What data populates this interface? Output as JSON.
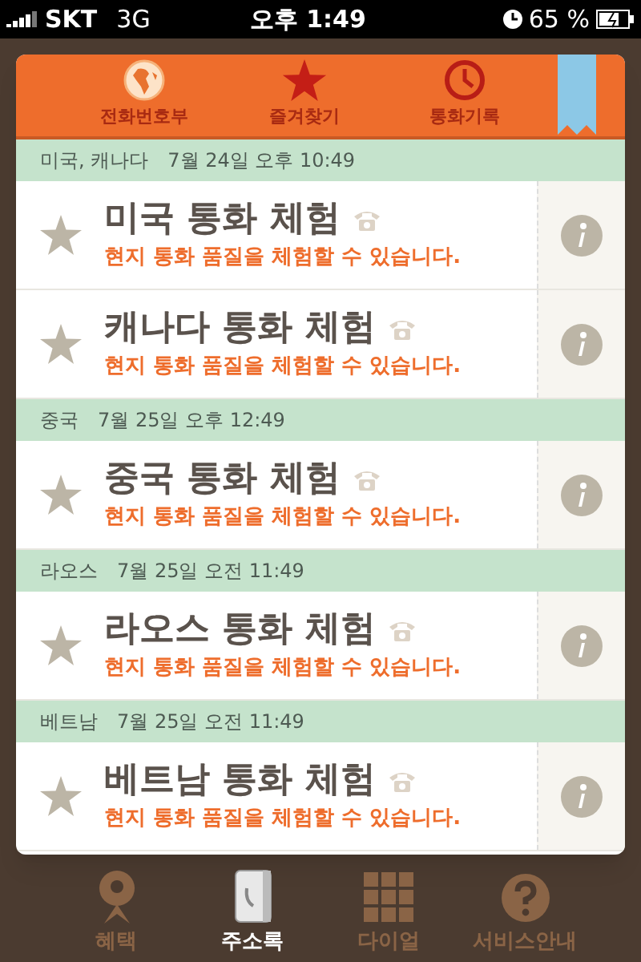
{
  "status_bar": {
    "carrier": "SKT",
    "network": "3G",
    "time": "오후 1:49",
    "battery": "65 %"
  },
  "top_tabs": [
    {
      "label": "전화번호부"
    },
    {
      "label": "즐겨찾기"
    },
    {
      "label": "통화기록"
    }
  ],
  "sections": [
    {
      "region": "미국, 캐나다",
      "date": "7월 24일 오후 10:49",
      "rows": [
        {
          "title": "미국 통화 체험",
          "subtitle": "현지 통화 품질을 체험할 수 있습니다.",
          "favorite": false
        },
        {
          "title": "캐나다 통화 체험",
          "subtitle": "현지 통화 품질을 체험할 수 있습니다.",
          "favorite": false
        }
      ]
    },
    {
      "region": "중국",
      "date": "7월 25일 오후 12:49",
      "rows": [
        {
          "title": "중국 통화 체험",
          "subtitle": "현지 통화 품질을 체험할 수 있습니다.",
          "favorite": false
        }
      ]
    },
    {
      "region": "라오스",
      "date": "7월 25일 오전 11:49",
      "rows": [
        {
          "title": "라오스 통화 체험",
          "subtitle": "현지 통화 품질을 체험할 수 있습니다.",
          "favorite": false
        }
      ]
    },
    {
      "region": "베트남",
      "date": "7월 25일 오전 11:49",
      "rows": [
        {
          "title": "베트남 통화 체험",
          "subtitle": "현지 통화 품질을 체험할 수 있습니다.",
          "favorite": false
        }
      ]
    }
  ],
  "bottom_tabs": [
    {
      "label": "혜택",
      "selected": false
    },
    {
      "label": "주소록",
      "selected": true
    },
    {
      "label": "다이얼",
      "selected": false
    },
    {
      "label": "서비스안내",
      "selected": false
    }
  ]
}
